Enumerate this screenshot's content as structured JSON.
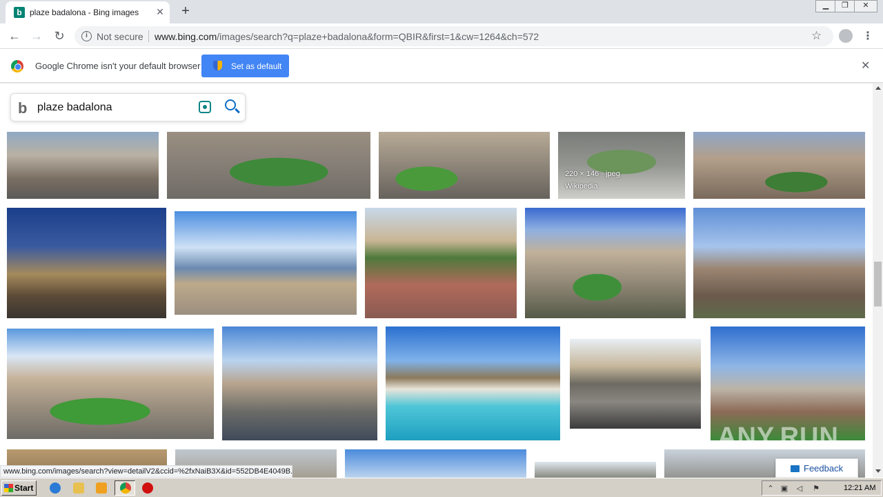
{
  "browser": {
    "tab_title": "plaze badalona - Bing images",
    "tab_favicon": "b",
    "tab_close": "✕",
    "new_tab": "+",
    "security_label": "Not secure",
    "url_host": "www.bing.com",
    "url_rest": "/images/search?q=plaze+badalona&form=QBIR&first=1&cw=1264&ch=572"
  },
  "infobar": {
    "message": "Google Chrome isn't your default browser",
    "button_label": "Set as default"
  },
  "search": {
    "query": "plaze badalona"
  },
  "results": {
    "hover_info": "220 × 146 · jpeg",
    "hover_source": "Wikipedia"
  },
  "status_bar": {
    "url": "www.bing.com/images/search?view=detailV2&ccid=%2fxNaiB3X&id=552DB4E4049B..."
  },
  "feedback": {
    "label": "Feedback"
  },
  "watermark": "ANY.RUN",
  "taskbar": {
    "start_label": "Start",
    "clock": "12:21 AM"
  },
  "colors": {
    "accent_blue": "#4285f4",
    "bing_teal": "#008373",
    "feedback_blue": "#1a4fa0"
  }
}
